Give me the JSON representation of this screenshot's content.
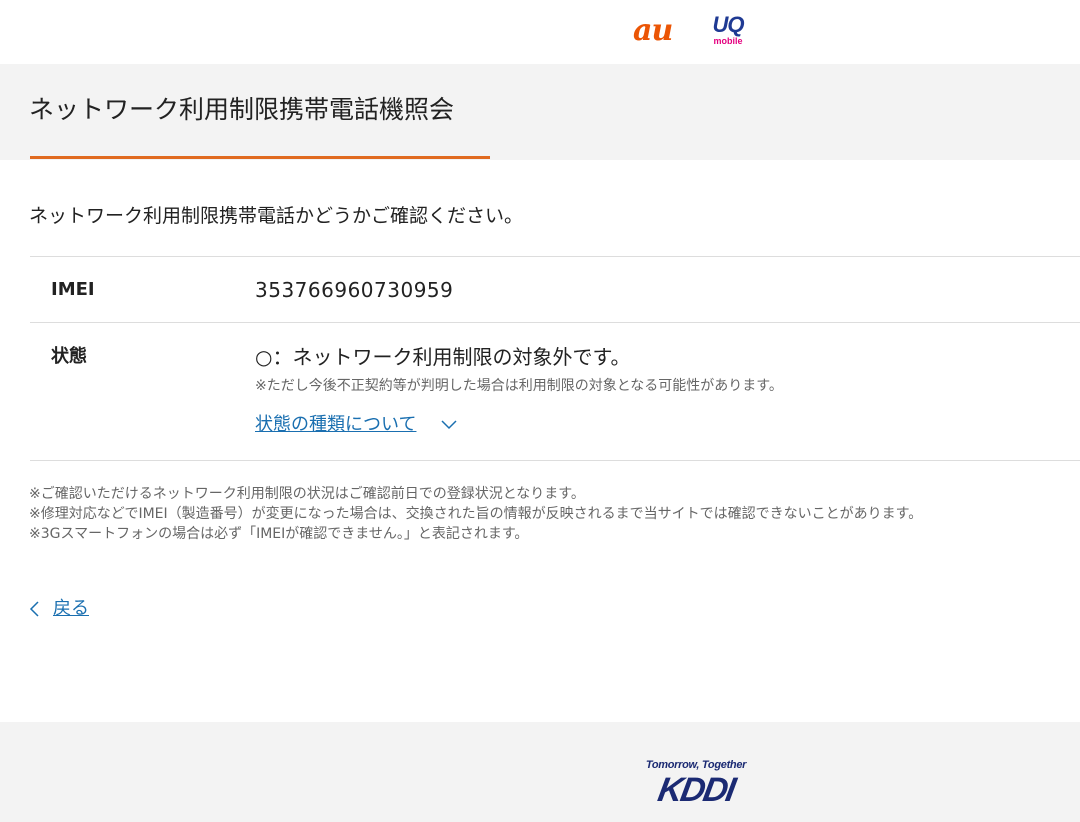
{
  "header": {
    "logo_au": "au",
    "logo_uq": "UQ",
    "logo_uq_sub": "mobile",
    "colors": {
      "au": "#eb5505",
      "uq": "#1f3a93",
      "uq_sub": "#e4007f"
    }
  },
  "title": {
    "text": "ネットワーク利用制限携帯電話機照会",
    "accent_color": "#e06a1f"
  },
  "lead": "ネットワーク利用制限携帯電話かどうかご確認ください。",
  "result": {
    "imei_label": "IMEI",
    "imei_value": "353766960730959",
    "status_label": "状態",
    "status_value": "○：ネットワーク利用制限の対象外です。",
    "status_note": "※ただし今後不正契約等が判明した場合は利用制限の対象となる可能性があります。",
    "status_link": "状態の種類について"
  },
  "notes": [
    "※ご確認いただけるネットワーク利用制限の状況はご確認前日での登録状況となります。",
    "※修理対応などでIMEI（製造番号）が変更になった場合は、交換された旨の情報が反映されるまで当サイトでは確認できないことがあります。",
    "※3Gスマートフォンの場合は必ず「IMEIが確認できません。」と表記されます。"
  ],
  "back_label": "戻る",
  "footer": {
    "tagline": "Tomorrow, Together",
    "brand": "KDDI",
    "brand_color": "#1b2a73"
  },
  "link_color": "#1a6fb0"
}
